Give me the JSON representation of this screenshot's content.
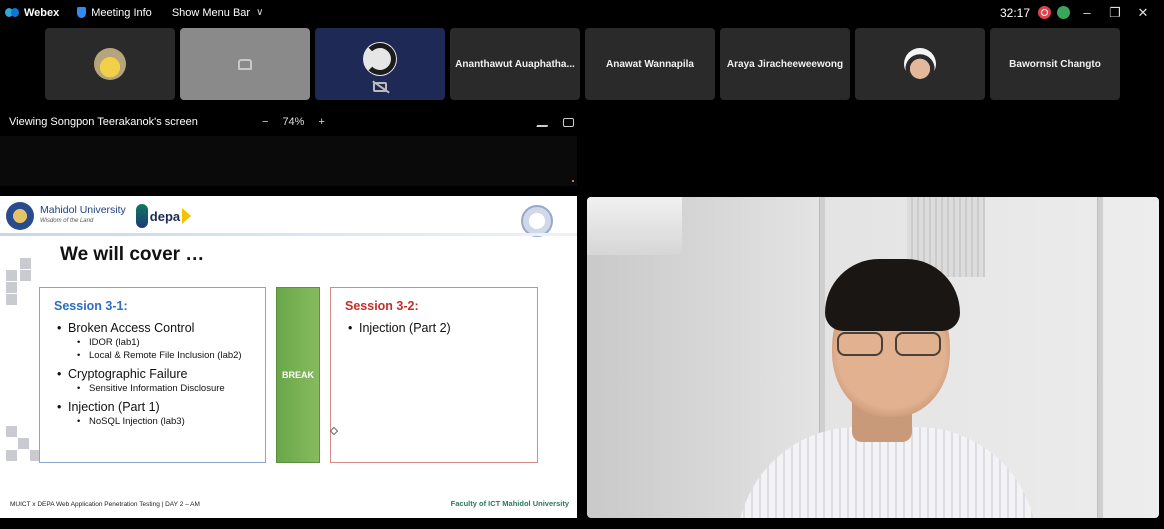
{
  "topbar": {
    "app_name": "Webex",
    "meeting_info": "Meeting Info",
    "menu_bar": "Show Menu Bar",
    "timer": "32:17"
  },
  "participants": [
    {
      "name": "",
      "kind": "avatar"
    },
    {
      "name": "",
      "kind": "placeholder"
    },
    {
      "name": "",
      "kind": "obs"
    },
    {
      "name": "Ananthawut Auaphatha...",
      "kind": "name"
    },
    {
      "name": "Anawat Wannapila",
      "kind": "name"
    },
    {
      "name": "Araya Jiracheeweewong",
      "kind": "name"
    },
    {
      "name": "",
      "kind": "avatar"
    },
    {
      "name": "Bawornsit Changto",
      "kind": "name"
    }
  ],
  "share": {
    "title": "Viewing Songpon Teerakanok's screen",
    "zoom_minus": "−",
    "zoom_level": "74%",
    "zoom_plus": "+"
  },
  "slide": {
    "university": "Mahidol University",
    "university_sub": "Wisdom of the Land",
    "partner": "depa",
    "title": "We will cover …",
    "session1": {
      "title": "Session 3-1:",
      "topic1": "Broken Access Control",
      "topic1_sub1": "IDOR (lab1)",
      "topic1_sub2": "Local & Remote File Inclusion (lab2)",
      "topic2": "Cryptographic Failure",
      "topic2_sub1": "Sensitive Information Disclosure",
      "topic3": "Injection (Part 1)",
      "topic3_sub1": "NoSQL Injection (lab3)"
    },
    "break_label": "BREAK",
    "session2": {
      "title": "Session 3-2:",
      "topic1": "Injection (Part 2)"
    },
    "footer_left": "MUICT x DEPA Web Application Penetration Testing | DAY 2 – AM",
    "footer_right": "Faculty of ICT Mahidol University"
  },
  "colors": {
    "session1_accent": "#2b6fc1",
    "session2_accent": "#c0302a",
    "break_fill": "#6aa74a",
    "recording_dot": "#e0424b"
  },
  "icons": [
    "webex-logo-icon",
    "shield-icon",
    "chevron-down-icon",
    "record-icon",
    "stats-icon",
    "minimize-icon",
    "restore-icon",
    "close-icon",
    "camera-off-icon",
    "annotate-icon",
    "popout-icon"
  ]
}
